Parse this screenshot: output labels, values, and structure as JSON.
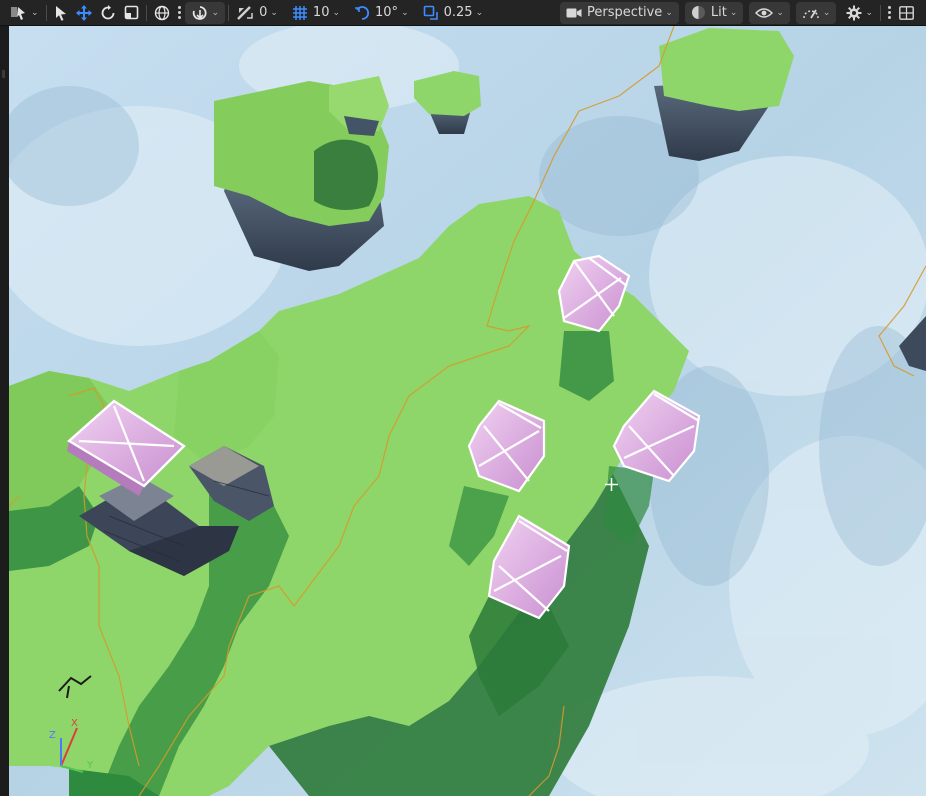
{
  "toolbar": {
    "snap_move_value": "0",
    "grid_snap_value": "10",
    "rotation_snap_value": "10°",
    "scale_snap_value": "0.25",
    "view_mode_label": "Perspective",
    "lighting_mode_label": "Lit"
  },
  "viewport": {
    "axis_z_label": "Z",
    "axis_x_label": "X",
    "axis_y_label": "Y"
  },
  "colors": {
    "toolbar_bg": "#242424",
    "accent_blue": "#3d8cff",
    "grass": "#8fd66a",
    "grass_shadow": "#2e8a3e",
    "crate_pink": "#e4b6e6",
    "sky": "#bcd7e6",
    "path_line": "#d59a2a"
  }
}
